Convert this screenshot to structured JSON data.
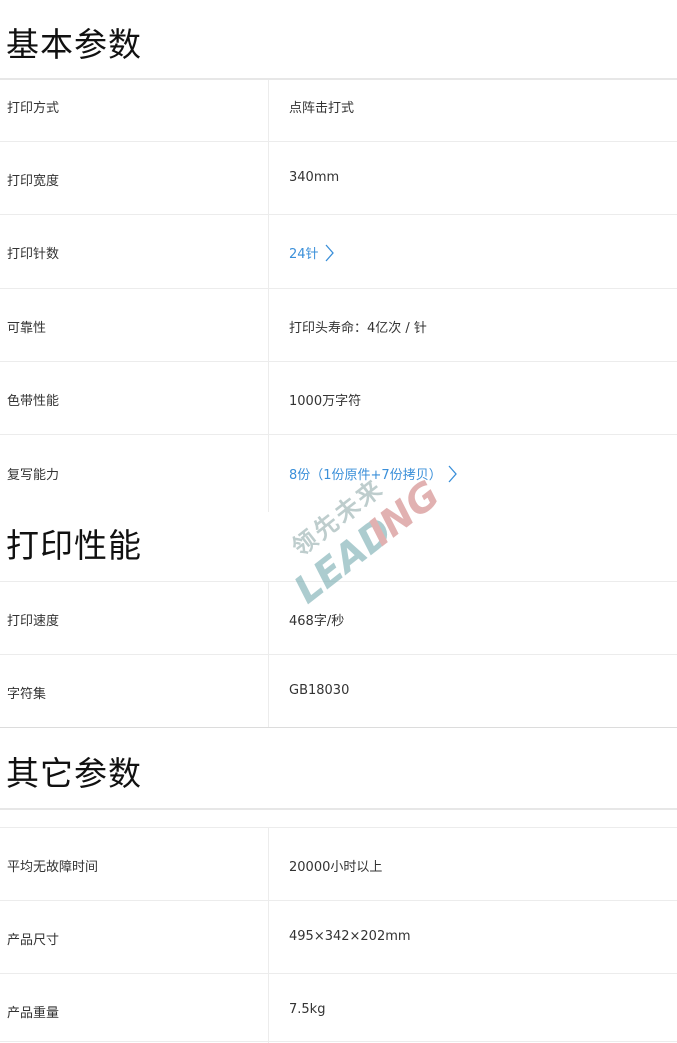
{
  "sections": [
    {
      "title": "基本参数",
      "rows": [
        {
          "label": "打印方式",
          "value": "点阵击打式",
          "link": false
        },
        {
          "label": "打印宽度",
          "value": "340mm",
          "link": false
        },
        {
          "label": "打印针数",
          "value": "24针",
          "link": true
        },
        {
          "label": "可靠性",
          "value": "打印头寿命：4亿次 / 针",
          "link": false
        },
        {
          "label": "色带性能",
          "value": "1000万字符",
          "link": false
        },
        {
          "label": "复写能力",
          "value": "8份（1份原件+7份拷贝）",
          "link": true
        }
      ]
    },
    {
      "title": "打印性能",
      "rows": [
        {
          "label": "打印速度",
          "value": "468字/秒",
          "link": false
        },
        {
          "label": "字符集",
          "value": "GB18030",
          "link": false
        }
      ]
    },
    {
      "title": "其它参数",
      "rows": [
        {
          "label": "平均无故障时间",
          "value": "20000小时以上",
          "link": false
        },
        {
          "label": "产品尺寸",
          "value": "495×342×202mm",
          "link": false
        },
        {
          "label": "产品重量",
          "value": "7.5kg",
          "link": false
        }
      ]
    }
  ],
  "watermark": {
    "text_cn": "领先未来",
    "text_en": "LEADING"
  },
  "colors": {
    "link": "#3a8fd9",
    "divider": "#ececec",
    "watermark_teal": "#5fa3a3",
    "watermark_red": "#c96b6b"
  }
}
